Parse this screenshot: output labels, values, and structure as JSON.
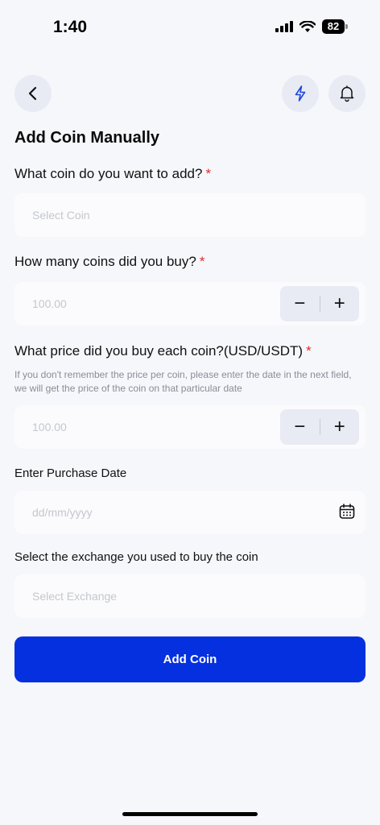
{
  "status": {
    "time": "1:40",
    "battery": "82"
  },
  "header": {
    "back_icon": "chevron-left-icon",
    "flash_icon": "lightning-icon",
    "bell_icon": "bell-icon"
  },
  "title": "Add Coin Manually",
  "coin": {
    "label": "What coin do you want to add?",
    "required": "*",
    "placeholder": "Select Coin"
  },
  "quantity": {
    "label": "How many coins did you buy?",
    "required": "*",
    "placeholder": "100.00",
    "minus": "−",
    "plus": "+"
  },
  "price": {
    "label": "What price did you buy each coin?(USD/USDT)",
    "required": "*",
    "hint": "If you don't remember the price per coin, please enter the date in the next field, we will get the price of the coin on that particular date",
    "placeholder": "100.00",
    "minus": "−",
    "plus": "+"
  },
  "date": {
    "label": "Enter Purchase Date",
    "placeholder": "dd/mm/yyyy",
    "icon": "calendar-icon"
  },
  "exchange": {
    "label": "Select the exchange you used to buy the coin",
    "placeholder": "Select Exchange"
  },
  "submit": {
    "label": "Add Coin"
  },
  "colors": {
    "primary": "#0530e0",
    "required": "#e12a2a",
    "background": "#f6f7fb"
  }
}
